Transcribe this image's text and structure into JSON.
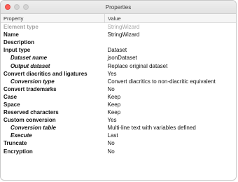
{
  "window": {
    "title": "Properties"
  },
  "table": {
    "headers": {
      "property": "Property",
      "value": "Value"
    },
    "rows": [
      {
        "property": "Element type",
        "value": "StringWizard",
        "level": 0,
        "muted": true
      },
      {
        "property": "Name",
        "value": "StringWizard",
        "level": 0
      },
      {
        "property": "Description",
        "value": "",
        "level": 0
      },
      {
        "property": "Input type",
        "value": "Dataset",
        "level": 0
      },
      {
        "property": "Dataset name",
        "value": "jsonDataset",
        "level": 1
      },
      {
        "property": "Output dataset",
        "value": "Replace original dataset",
        "level": 1
      },
      {
        "property": "Convert diacritics and ligatures",
        "value": "Yes",
        "level": 0
      },
      {
        "property": "Conversion type",
        "value": "Convert diacritics to non-diacritic equivalent",
        "level": 1
      },
      {
        "property": "Convert trademarks",
        "value": "No",
        "level": 0
      },
      {
        "property": "Case",
        "value": "Keep",
        "level": 0
      },
      {
        "property": "Space",
        "value": "Keep",
        "level": 0
      },
      {
        "property": "Reserved characters",
        "value": "Keep",
        "level": 0
      },
      {
        "property": "Custom conversion",
        "value": "Yes",
        "level": 0
      },
      {
        "property": "Conversion table",
        "value": "Multi-line text with variables defined",
        "level": 1
      },
      {
        "property": "Execute",
        "value": "Last",
        "level": 1
      },
      {
        "property": "Truncate",
        "value": "No",
        "level": 0
      },
      {
        "property": "Encryption",
        "value": "No",
        "level": 0
      }
    ]
  },
  "colors": {
    "close_button": "#ff5f57",
    "inactive_button": "#d4d4d4",
    "muted_text": "#a6a6a6"
  }
}
